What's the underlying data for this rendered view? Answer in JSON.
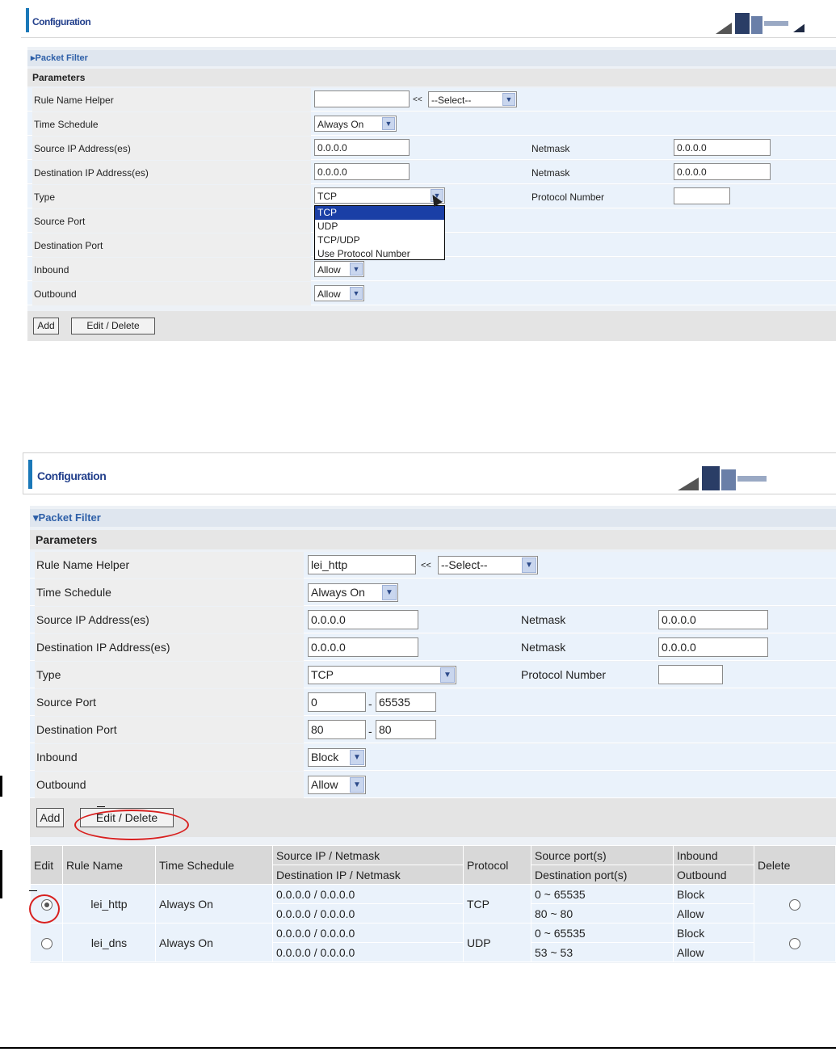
{
  "panel1": {
    "title": "Configuration",
    "section": "▸Packet Filter",
    "params_label": "Parameters",
    "rows": {
      "rule_name": {
        "label": "Rule Name  Helper",
        "value": "",
        "arrow": "<<",
        "select": "--Select--"
      },
      "time_schedule": {
        "label": "Time Schedule",
        "select": "Always On"
      },
      "src_ip": {
        "label": "Source IP Address(es)",
        "value": "0.0.0.0",
        "netmask_label": "Netmask",
        "netmask": "0.0.0.0"
      },
      "dst_ip": {
        "label": "Destination IP Address(es)",
        "value": "0.0.0.0",
        "netmask_label": "Netmask",
        "netmask": "0.0.0.0"
      },
      "type": {
        "label": "Type",
        "select": "TCP",
        "proto_label": "Protocol Number",
        "proto_value": ""
      },
      "src_port": {
        "label": "Source Port"
      },
      "dst_port": {
        "label": "Destination Port"
      },
      "inbound": {
        "label": "Inbound",
        "select": "Allow"
      },
      "outbound": {
        "label": "Outbound",
        "select": "Allow"
      }
    },
    "type_options": [
      "TCP",
      "UDP",
      "TCP/UDP",
      "Use Protocol Number"
    ],
    "highlighted_option": "TCP",
    "add_label": "Add",
    "edit_delete_label": "Edit / Delete"
  },
  "panel2": {
    "title": "Configuration",
    "section": "▾Packet Filter",
    "params_label": "Parameters",
    "rows": {
      "rule_name": {
        "label": "Rule Name  Helper",
        "value": "lei_http",
        "arrow": "<<",
        "select": "--Select--"
      },
      "time_schedule": {
        "label": "Time Schedule",
        "select": "Always On"
      },
      "src_ip": {
        "label": "Source IP Address(es)",
        "value": "0.0.0.0",
        "netmask_label": "Netmask",
        "netmask": "0.0.0.0"
      },
      "dst_ip": {
        "label": "Destination IP Address(es)",
        "value": "0.0.0.0",
        "netmask_label": "Netmask",
        "netmask": "0.0.0.0"
      },
      "type": {
        "label": "Type",
        "select": "TCP",
        "proto_label": "Protocol Number",
        "proto_value": ""
      },
      "src_port": {
        "label": "Source Port",
        "from": "0",
        "sep": "-",
        "to": "65535"
      },
      "dst_port": {
        "label": "Destination Port",
        "from": "80",
        "sep": "-",
        "to": "80"
      },
      "inbound": {
        "label": "Inbound",
        "select": "Block"
      },
      "outbound": {
        "label": "Outbound",
        "select": "Allow"
      }
    },
    "add_label": "Add",
    "edit_delete_label": "Edit / Delete",
    "table": {
      "headers": {
        "edit": "Edit",
        "rule_name": "Rule Name",
        "time_schedule": "Time Schedule",
        "src_ip": "Source IP / Netmask",
        "dst_ip": "Destination IP / Netmask",
        "protocol": "Protocol",
        "src_ports": "Source port(s)",
        "dst_ports": "Destination port(s)",
        "inbound": "Inbound",
        "outbound": "Outbound",
        "delete": "Delete"
      },
      "rows": [
        {
          "selected": true,
          "rule_name": "lei_http",
          "time_schedule": "Always On",
          "src_ip": "0.0.0.0 / 0.0.0.0",
          "dst_ip": "0.0.0.0 / 0.0.0.0",
          "protocol": "TCP",
          "src_ports": "0 ~ 65535",
          "dst_ports": "80 ~ 80",
          "inbound": "Block",
          "outbound": "Allow"
        },
        {
          "selected": false,
          "rule_name": "lei_dns",
          "time_schedule": "Always On",
          "src_ip": "0.0.0.0 / 0.0.0.0",
          "dst_ip": "0.0.0.0 / 0.0.0.0",
          "protocol": "UDP",
          "src_ports": "0 ~ 65535",
          "dst_ports": "53 ~ 53",
          "inbound": "Block",
          "outbound": "Allow"
        }
      ]
    }
  },
  "colors": {
    "accent": "#1a78b8",
    "title": "#23408c",
    "highlight": "#1a3fa6",
    "annotation": "#d8201f"
  },
  "icons": [
    "chevron-down-icon",
    "radio-icon",
    "pointer-cursor-icon",
    "header-logo-graphic"
  ]
}
